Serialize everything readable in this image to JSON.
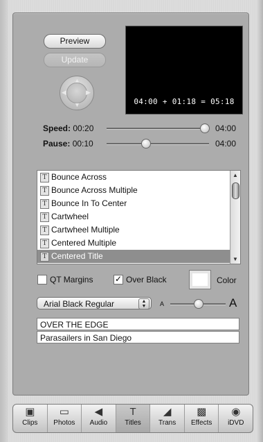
{
  "controls": {
    "preview_label": "Preview",
    "update_label": "Update"
  },
  "preview": {
    "timecode": "04:00 + 01:18 = 05:18"
  },
  "sliders": {
    "speed": {
      "label": "Speed:",
      "value": "00:20",
      "max": "04:00",
      "level": 0.95
    },
    "pause": {
      "label": "Pause:",
      "value": "00:10",
      "max": "04:00",
      "level": 0.38
    }
  },
  "title_list": {
    "items": [
      {
        "label": "Bounce Across",
        "icon": "T"
      },
      {
        "label": "Bounce Across Multiple",
        "icon": "T"
      },
      {
        "label": "Bounce In To Center",
        "icon": "T"
      },
      {
        "label": "Cartwheel",
        "icon": "T"
      },
      {
        "label": "Cartwheel Multiple",
        "icon": "T"
      },
      {
        "label": "Centered Multiple",
        "icon": "T"
      },
      {
        "label": "Centered Title",
        "icon": "T",
        "selected": true
      }
    ]
  },
  "options": {
    "qt_margins": {
      "label": "QT Margins",
      "checked": false
    },
    "over_black": {
      "label": "Over Black",
      "checked": true
    },
    "color_label": "Color"
  },
  "font": {
    "selected": "Arial Black Regular",
    "size_small": "A",
    "size_large": "A",
    "size_level": 0.5
  },
  "text_fields": {
    "line1": "OVER THE EDGE",
    "line2": "Parasailers in San Diego"
  },
  "toolbar": {
    "tabs": [
      {
        "label": "Clips",
        "icon": "clips-icon",
        "glyph": "▣"
      },
      {
        "label": "Photos",
        "icon": "photos-icon",
        "glyph": "▭"
      },
      {
        "label": "Audio",
        "icon": "audio-icon",
        "glyph": "◀"
      },
      {
        "label": "Titles",
        "icon": "titles-icon",
        "glyph": "T",
        "active": true
      },
      {
        "label": "Trans",
        "icon": "trans-icon",
        "glyph": "◢"
      },
      {
        "label": "Effects",
        "icon": "effects-icon",
        "glyph": "▩"
      },
      {
        "label": "iDVD",
        "icon": "idvd-icon",
        "glyph": "◉"
      }
    ]
  }
}
